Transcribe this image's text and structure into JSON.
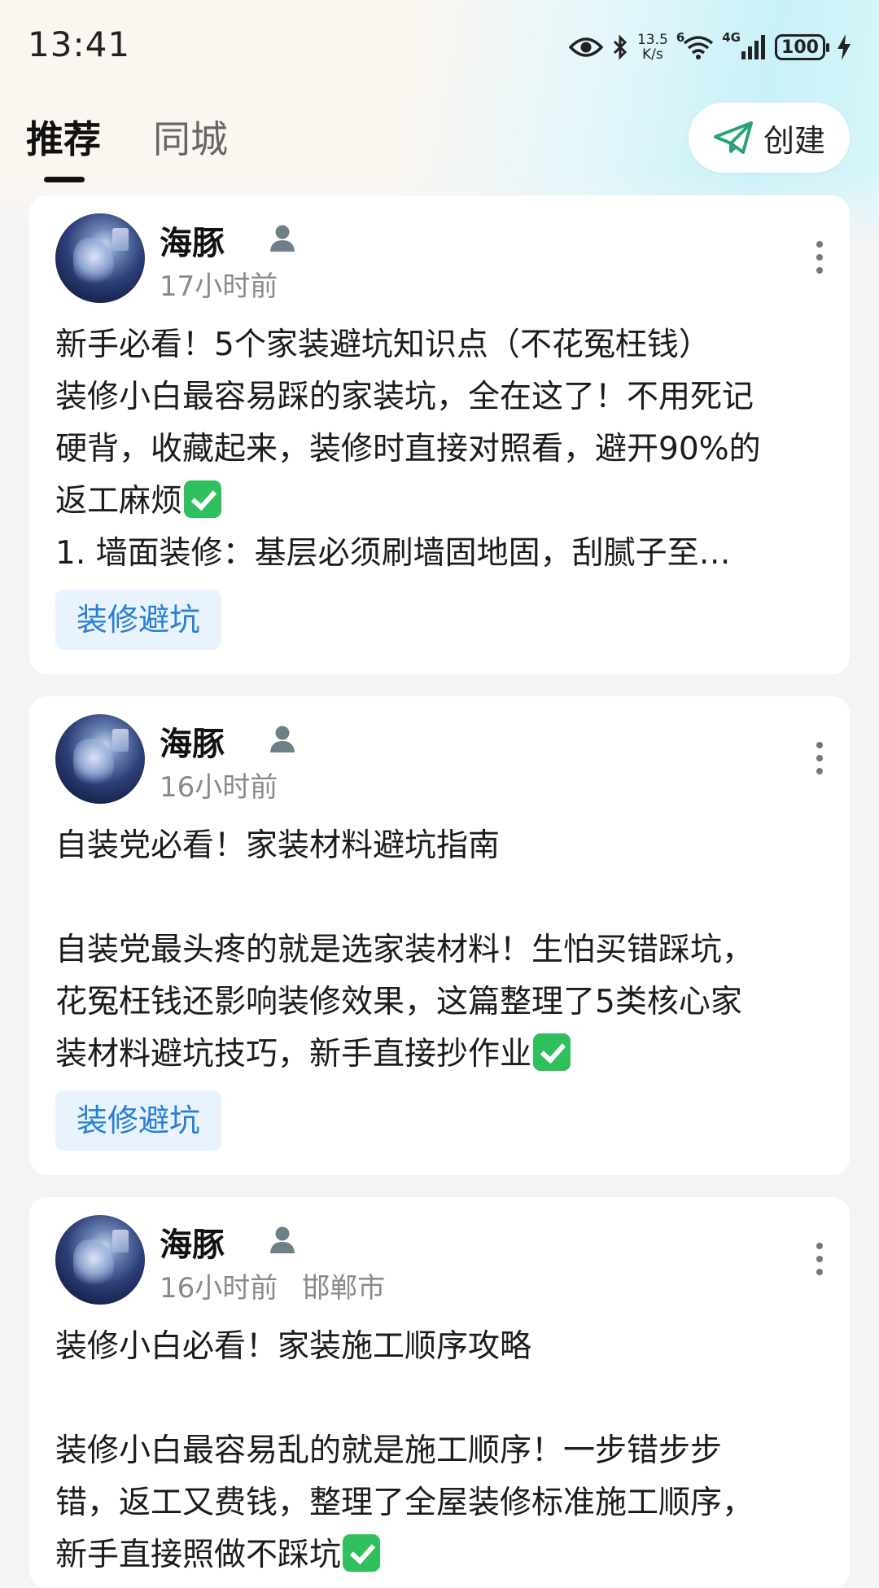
{
  "status_bar": {
    "time": "13:41",
    "speed_top": "13.5",
    "speed_bottom": "K/s",
    "wifi_label": "6",
    "signal_label": "4G",
    "battery": "100"
  },
  "tabs": [
    {
      "label": "推荐",
      "active": true
    },
    {
      "label": "同城",
      "active": false
    }
  ],
  "create_button": {
    "label": "创建",
    "icon": "paper-plane-icon"
  },
  "posts": [
    {
      "user": "海豚",
      "time": "17小时前",
      "location": "",
      "lines": [
        "新手必看！5个家装避坑知识点（不花冤枉钱）",
        "装修小白最容易踩的家装坑，全在这了！不用死记",
        "硬背，收藏起来，装修时直接对照看，避开90%的",
        "返工麻烦",
        "1. 墙面装修：基层必须刷墙固地固，刮腻子至…"
      ],
      "tag": "装修避坑"
    },
    {
      "user": "海豚",
      "time": "16小时前",
      "location": "",
      "lines": [
        "自装党必看！家装材料避坑指南",
        "",
        "自装党最头疼的就是选家装材料！生怕买错踩坑，",
        "花冤枉钱还影响装修效果，这篇整理了5类核心家",
        "装材料避坑技巧，新手直接抄作业"
      ],
      "tag": "装修避坑"
    },
    {
      "user": "海豚",
      "time": "16小时前",
      "location": "邯郸市",
      "lines": [
        "装修小白必看！家装施工顺序攻略",
        "",
        "装修小白最容易乱的就是施工顺序！一步错步步",
        "错，返工又费钱，整理了全屋装修标准施工顺序，",
        "新手直接照做不踩坑"
      ],
      "tag": ""
    }
  ]
}
